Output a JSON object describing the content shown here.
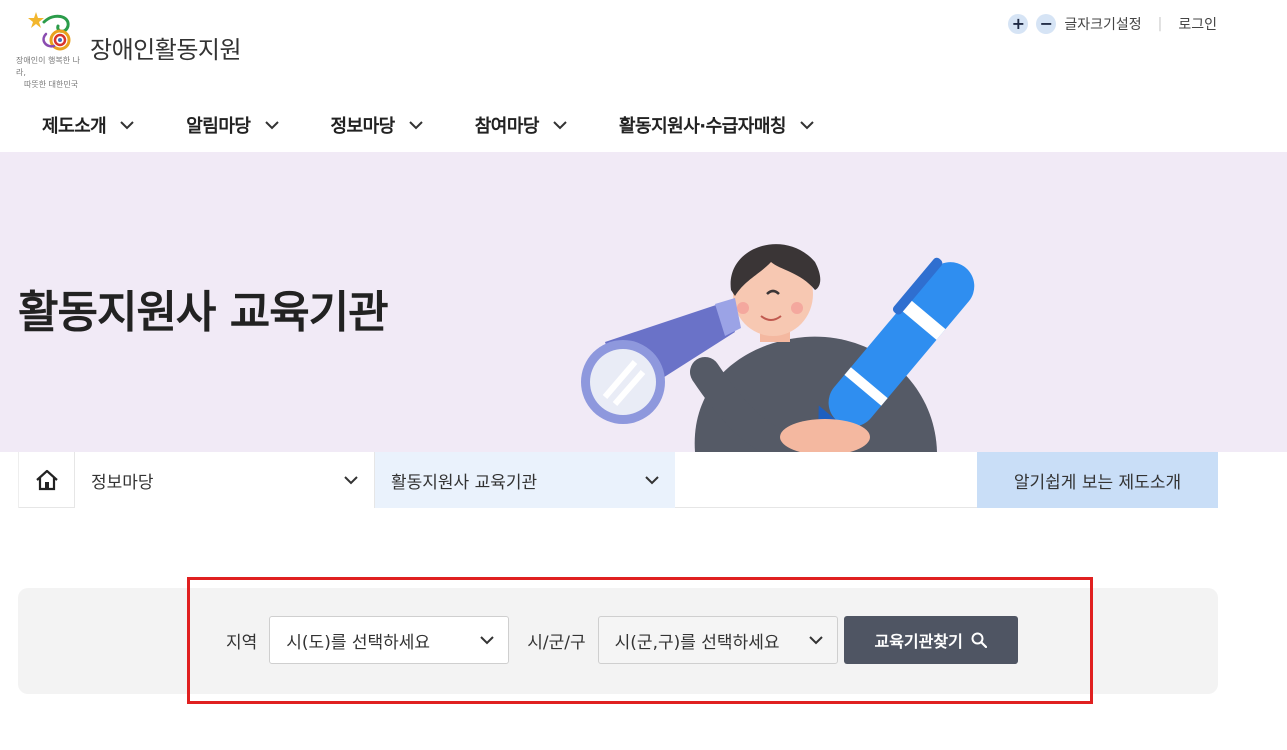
{
  "header": {
    "site_title": "장애인활동지원",
    "slogan_line1": "장애인이 행복한 나라,",
    "slogan_line2": "따뜻한 대한민국",
    "font_setting_label": "글자크기설정",
    "login_label": "로그인",
    "increase_symbol": "+",
    "decrease_symbol": "−"
  },
  "gnb": [
    {
      "label": "제도소개"
    },
    {
      "label": "알림마당"
    },
    {
      "label": "정보마당"
    },
    {
      "label": "참여마당"
    },
    {
      "label": "활동지원사·수급자매칭"
    }
  ],
  "hero": {
    "title": "활동지원사 교육기관"
  },
  "breadcrumb": {
    "home_icon": "home-icon",
    "level1": "정보마당",
    "level2": "활동지원사 교육기관",
    "guide_button": "알기쉽게 보는 제도소개"
  },
  "search": {
    "region_label": "지역",
    "region_placeholder": "시(도)를 선택하세요",
    "district_label": "시/군/구",
    "district_placeholder": "시(군,구)를 선택하세요",
    "button_label": "교육기관찾기"
  },
  "colors": {
    "hero_bg": "#f1eaf6",
    "guide_bg": "#c9def7",
    "level2_bg": "#eaf2fc",
    "search_btn": "#4f5563",
    "highlight": "#e02020"
  }
}
